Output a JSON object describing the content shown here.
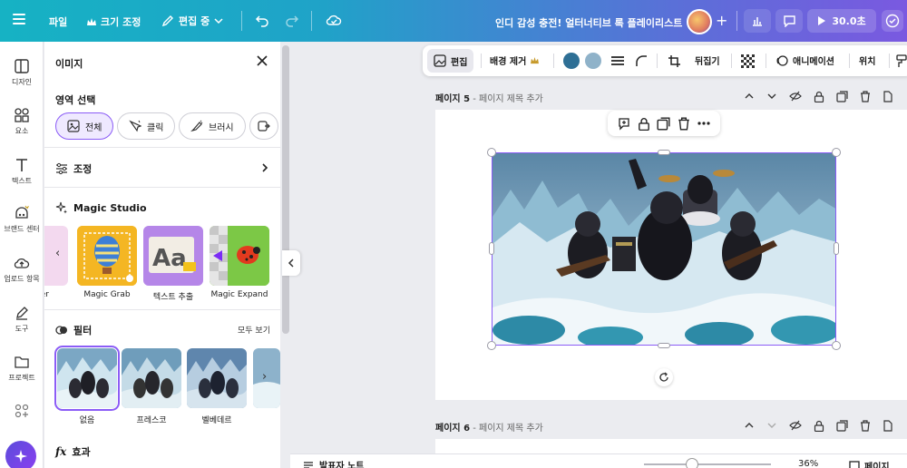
{
  "topbar": {
    "file_label": "파일",
    "resize_label": "크기 조정",
    "edit_mode_label": "편집 중",
    "doc_title": "인디 감성 충전! 얼터너티브 록 플레이리스트",
    "present_label": "30.0초"
  },
  "rail": {
    "items": [
      {
        "label": "디자인",
        "icon": "layout-icon"
      },
      {
        "label": "요소",
        "icon": "shapes-icon"
      },
      {
        "label": "텍스트",
        "icon": "text-icon"
      },
      {
        "label": "브랜드 센터",
        "icon": "brand-icon"
      },
      {
        "label": "업로드 항목",
        "icon": "upload-icon"
      },
      {
        "label": "도구",
        "icon": "pen-icon"
      },
      {
        "label": "프로젝트",
        "icon": "folder-icon"
      },
      {
        "label": "",
        "icon": "apps-icon"
      }
    ]
  },
  "panel": {
    "title": "이미지",
    "area_select_title": "영역 선택",
    "chips": [
      {
        "label": "전체",
        "active": true
      },
      {
        "label": "클릭",
        "active": false
      },
      {
        "label": "브러시",
        "active": false
      }
    ],
    "adjust_label": "조정",
    "magic_studio_title": "Magic Studio",
    "magic_items": [
      {
        "label": "ser"
      },
      {
        "label": "Magic Grab"
      },
      {
        "label": "텍스트 추출"
      },
      {
        "label": "Magic Expand"
      }
    ],
    "filter_title": "필터",
    "see_all_label": "모두 보기",
    "filters": [
      {
        "label": "없음",
        "selected": true
      },
      {
        "label": "프레스코",
        "selected": false
      },
      {
        "label": "벨베데르",
        "selected": false
      }
    ],
    "effects_title": "효과"
  },
  "context_toolbar": {
    "edit_label": "편집",
    "bg_remove_label": "배경 제거",
    "flip_label": "뒤집기",
    "animate_label": "애니메이션",
    "position_label": "위치",
    "color_primary": "#2e6f95",
    "color_secondary": "#8fb2c9"
  },
  "canvas": {
    "page5_header": "페이지 5",
    "page5_subtitle": "- 페이지 제목 추가",
    "page6_header": "페이지 6",
    "page6_subtitle": "- 페이지 제목 추가"
  },
  "bottombar": {
    "notes_label": "발표자 노트",
    "zoom_label": "36%",
    "pages_label": "페이지"
  },
  "colors": {
    "accent": "#8b5cf6",
    "topbar_start": "#16b2c4",
    "topbar_end": "#7a59e0"
  }
}
